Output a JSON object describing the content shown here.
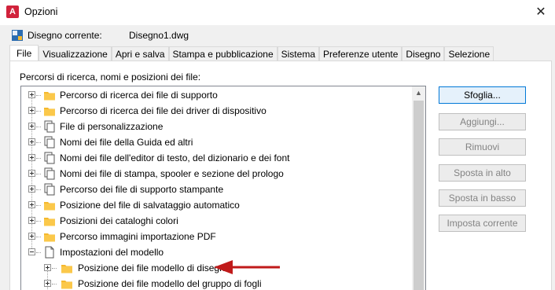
{
  "window": {
    "title": "Opzioni",
    "app_icon_letter": "A",
    "close_glyph": "✕"
  },
  "drawing": {
    "label": "Disegno corrente:",
    "value": "Disegno1.dwg"
  },
  "tabs": [
    {
      "label": "File",
      "active": true
    },
    {
      "label": "Visualizzazione"
    },
    {
      "label": "Apri e salva"
    },
    {
      "label": "Stampa e pubblicazione"
    },
    {
      "label": "Sistema"
    },
    {
      "label": "Preferenze utente"
    },
    {
      "label": "Disegno"
    },
    {
      "label": "Selezione"
    }
  ],
  "panel": {
    "label": "Percorsi di ricerca, nomi e posizioni dei file:"
  },
  "tree": {
    "items": [
      {
        "label": "Percorso di ricerca dei file di supporto",
        "icon": "folder-icon",
        "expander": "plus",
        "level": 0
      },
      {
        "label": "Percorso di ricerca dei file dei driver di dispositivo",
        "icon": "folder-icon",
        "expander": "plus",
        "level": 0
      },
      {
        "label": "File di personalizzazione",
        "icon": "files-icon",
        "expander": "plus",
        "level": 0
      },
      {
        "label": "Nomi dei file della Guida ed altri",
        "icon": "files-icon",
        "expander": "plus",
        "level": 0
      },
      {
        "label": "Nomi dei file dell'editor di testo, del dizionario e dei font",
        "icon": "files-icon",
        "expander": "plus",
        "level": 0
      },
      {
        "label": "Nomi dei file di stampa, spooler e sezione del prologo",
        "icon": "files-icon",
        "expander": "plus",
        "level": 0
      },
      {
        "label": "Percorso dei file di supporto stampante",
        "icon": "files-icon",
        "expander": "plus",
        "level": 0
      },
      {
        "label": "Posizione del file di salvataggio automatico",
        "icon": "folder-icon",
        "expander": "plus",
        "level": 0
      },
      {
        "label": "Posizioni dei cataloghi colori",
        "icon": "folder-icon",
        "expander": "plus",
        "level": 0
      },
      {
        "label": "Percorso immagini importazione PDF",
        "icon": "folder-icon",
        "expander": "plus",
        "level": 0
      },
      {
        "label": "Impostazioni del modello",
        "icon": "document-icon",
        "expander": "minus",
        "level": 0
      },
      {
        "label": "Posizione dei file modello di disegno",
        "icon": "folder-icon",
        "expander": "plus",
        "level": 1
      },
      {
        "label": "Posizione dei file modello del gruppo di fogli",
        "icon": "folder-icon",
        "expander": "plus",
        "level": 1
      }
    ]
  },
  "buttons": [
    {
      "label": "Sfoglia...",
      "state": "default"
    },
    {
      "label": "Aggiungi...",
      "state": "disabled"
    },
    {
      "label": "Rimuovi",
      "state": "disabled"
    },
    {
      "label": "Sposta in alto",
      "state": "disabled"
    },
    {
      "label": "Sposta in basso",
      "state": "disabled"
    },
    {
      "label": "Imposta corrente",
      "state": "disabled"
    }
  ],
  "colors": {
    "folder": "#f5b82e",
    "arrow": "#c01a1a",
    "app_icon": "#d1223b",
    "focus_border": "#0078d7"
  }
}
